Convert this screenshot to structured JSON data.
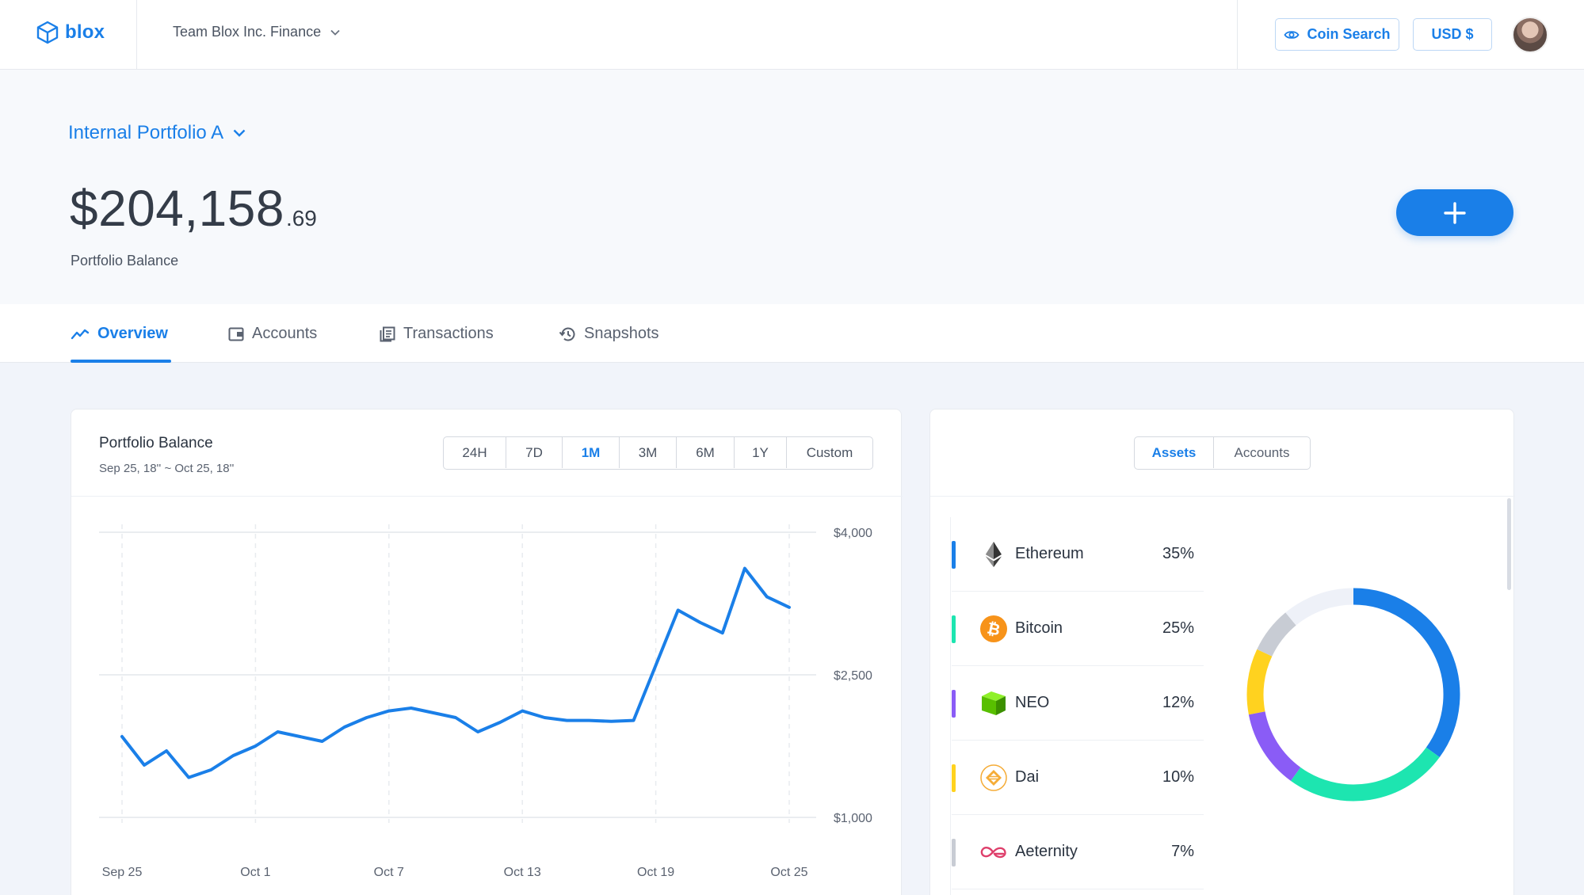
{
  "nav": {
    "logo_text": "blox",
    "team_name": "Team Blox Inc. Finance",
    "coin_search_label": "Coin Search",
    "currency_label": "USD $"
  },
  "portfolio": {
    "name": "Internal Portfolio A",
    "balance_main": "$204,158",
    "balance_cents": ".69",
    "balance_label": "Portfolio Balance"
  },
  "tabs": [
    {
      "label": "Overview",
      "icon": "trend-line-icon",
      "active": true
    },
    {
      "label": "Accounts",
      "icon": "wallet-icon",
      "active": false
    },
    {
      "label": "Transactions",
      "icon": "document-list-icon",
      "active": false
    },
    {
      "label": "Snapshots",
      "icon": "history-icon",
      "active": false
    }
  ],
  "chart_card": {
    "title": "Portfolio Balance",
    "date_range": "Sep 25, 18'' ~ Oct 25, 18''",
    "ranges": [
      "24H",
      "7D",
      "1M",
      "3M",
      "6M",
      "1Y",
      "Custom"
    ],
    "active_range": "1M"
  },
  "chart_data": {
    "type": "line",
    "x": [
      "Sep 25",
      "Sep 26",
      "Sep 27",
      "Sep 28",
      "Sep 29",
      "Sep 30",
      "Oct 1",
      "Oct 2",
      "Oct 3",
      "Oct 4",
      "Oct 5",
      "Oct 6",
      "Oct 7",
      "Oct 8",
      "Oct 9",
      "Oct 10",
      "Oct 11",
      "Oct 12",
      "Oct 13",
      "Oct 14",
      "Oct 15",
      "Oct 16",
      "Oct 17",
      "Oct 18",
      "Oct 19",
      "Oct 20",
      "Oct 21",
      "Oct 22",
      "Oct 23",
      "Oct 24",
      "Oct 25"
    ],
    "series": [
      {
        "name": "",
        "values": [
          1850,
          1550,
          1700,
          1420,
          1500,
          1650,
          1750,
          1900,
          1850,
          1800,
          1950,
          2050,
          2120,
          2150,
          2100,
          2050,
          1900,
          2000,
          2120,
          2050,
          2020,
          2020,
          2010,
          2020,
          2600,
          3180,
          3050,
          2940,
          3620,
          3320,
          3210
        ]
      },
      {
        "name": "",
        "values": []
      }
    ],
    "xticks": [
      "Sep 25",
      "Oct 1",
      "Oct 7",
      "Oct 13",
      "Oct 19",
      "Oct 25"
    ],
    "yticks": [
      "$4,000",
      "$2,500",
      "$1,000"
    ],
    "ylim": [
      1000,
      4000
    ],
    "color": "#1a7fe8",
    "grid": true
  },
  "assets_card": {
    "toggle": [
      "Assets",
      "Accounts"
    ],
    "active_toggle": "Assets",
    "assets": [
      {
        "name": "Ethereum",
        "percent": "35%",
        "value": 35,
        "color": "#1a7fe8",
        "icon": "ethereum-icon"
      },
      {
        "name": "Bitcoin",
        "percent": "25%",
        "value": 25,
        "color": "#1de5b0",
        "icon": "bitcoin-icon"
      },
      {
        "name": "NEO",
        "percent": "12%",
        "value": 12,
        "color": "#8a5cf6",
        "icon": "neo-icon"
      },
      {
        "name": "Dai",
        "percent": "10%",
        "value": 10,
        "color": "#ffd21f",
        "icon": "dai-icon"
      },
      {
        "name": "Aeternity",
        "percent": "7%",
        "value": 7,
        "color": "#c8ccd4",
        "icon": "aeternity-icon"
      }
    ],
    "donut_remainder_value": 11,
    "donut_remainder_color": "#eef1f8"
  }
}
